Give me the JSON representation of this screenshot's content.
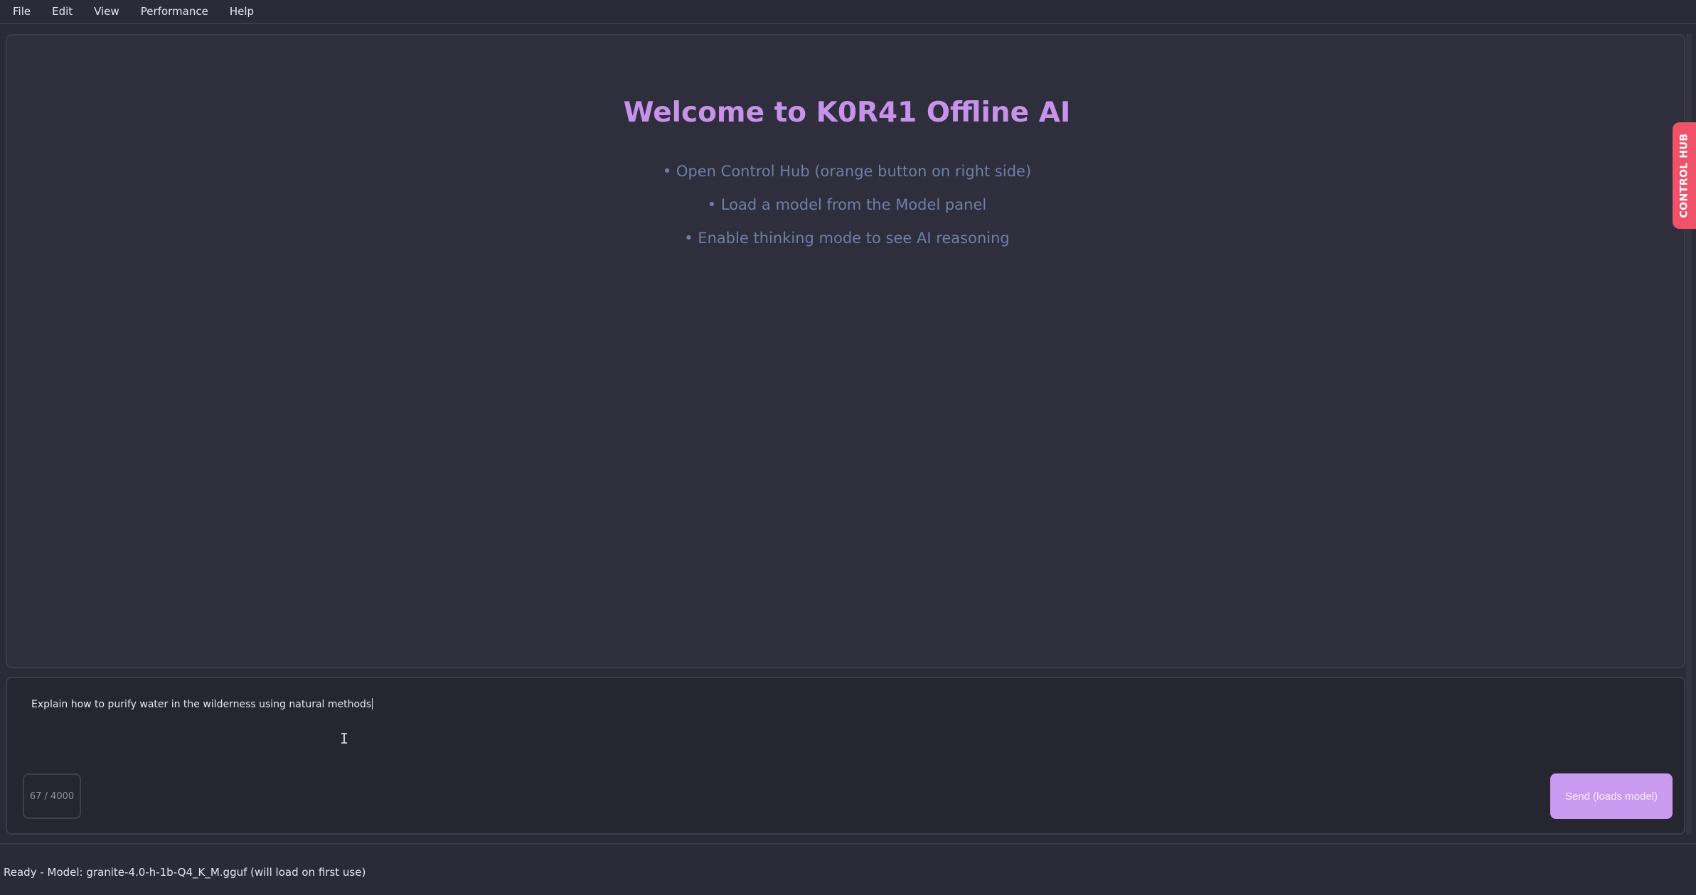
{
  "menu": {
    "items": [
      "File",
      "Edit",
      "View",
      "Performance",
      "Help"
    ]
  },
  "welcome": {
    "title": "Welcome to K0R41 Offline AI",
    "tips": [
      "• Open Control Hub (orange button on right side)",
      "• Load a model from the Model panel",
      "• Enable thinking mode to see AI reasoning"
    ]
  },
  "control_hub": {
    "label": "CONTROL HUB",
    "color": "#f0526a"
  },
  "composer": {
    "value": "Explain how to purify water in the wilderness using natural methods",
    "char_count": "67 / 4000",
    "send_label": "Send (loads model)"
  },
  "status": {
    "text": "Ready - Model: granite-4.0-h-1b-Q4_K_M.gguf (will load on first use)"
  },
  "colors": {
    "accent": "#c792ea",
    "send_button": "#c99af0",
    "background": "#2b2b37"
  }
}
